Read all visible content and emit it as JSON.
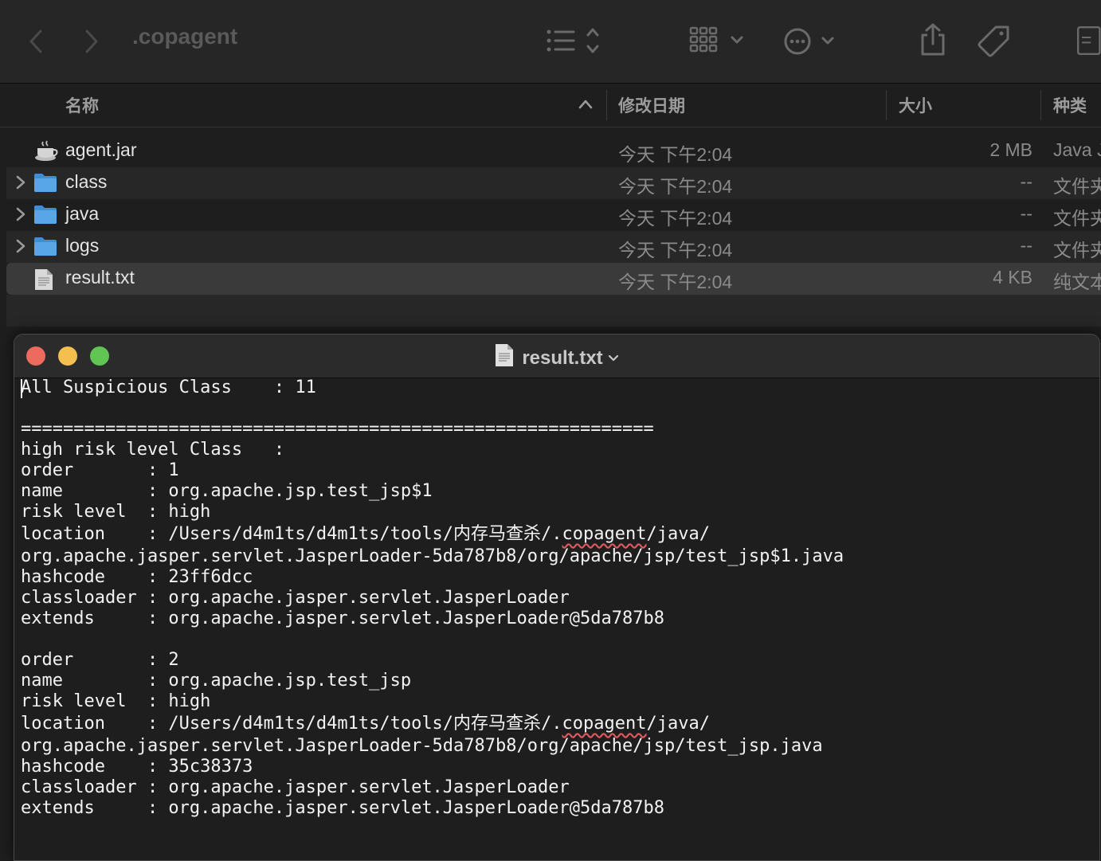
{
  "finder": {
    "title": ".copagent",
    "columns": {
      "name": "名称",
      "date": "修改日期",
      "size": "大小",
      "kind": "种类"
    },
    "files": [
      {
        "name": "agent.jar",
        "date": "今天 下午2:04",
        "size": "2 MB",
        "kind": "Java JAR",
        "icon": "java-jar-icon",
        "folder": false
      },
      {
        "name": "class",
        "date": "今天 下午2:04",
        "size": "--",
        "kind": "文件夹",
        "icon": "folder-icon",
        "folder": true
      },
      {
        "name": "java",
        "date": "今天 下午2:04",
        "size": "--",
        "kind": "文件夹",
        "icon": "folder-icon",
        "folder": true
      },
      {
        "name": "logs",
        "date": "今天 下午2:04",
        "size": "--",
        "kind": "文件夹",
        "icon": "folder-icon",
        "folder": true
      },
      {
        "name": "result.txt",
        "date": "今天 下午2:04",
        "size": "4 KB",
        "kind": "纯文本",
        "icon": "text-document-icon",
        "folder": false
      }
    ]
  },
  "editor": {
    "title": "result.txt",
    "lines": [
      "All Suspicious Class    : 11",
      "",
      "============================================================",
      "high risk level Class   :",
      "order       : 1",
      "name        : org.apache.jsp.test_jsp$1",
      "risk level  : high",
      "location    : /Users/d4m1ts/d4m1ts/tools/内存马查杀/.copagent/java/",
      "org.apache.jasper.servlet.JasperLoader-5da787b8/org/apache/jsp/test_jsp$1.java",
      "hashcode    : 23ff6dcc",
      "classloader : org.apache.jasper.servlet.JasperLoader",
      "extends     : org.apache.jasper.servlet.JasperLoader@5da787b8",
      "",
      "order       : 2",
      "name        : org.apache.jsp.test_jsp",
      "risk level  : high",
      "location    : /Users/d4m1ts/d4m1ts/tools/内存马查杀/.copagent/java/",
      "org.apache.jasper.servlet.JasperLoader-5da787b8/org/apache/jsp/test_jsp.java",
      "hashcode    : 35c38373",
      "classloader : org.apache.jasper.servlet.JasperLoader",
      "extends     : org.apache.jasper.servlet.JasperLoader@5da787b8"
    ]
  }
}
